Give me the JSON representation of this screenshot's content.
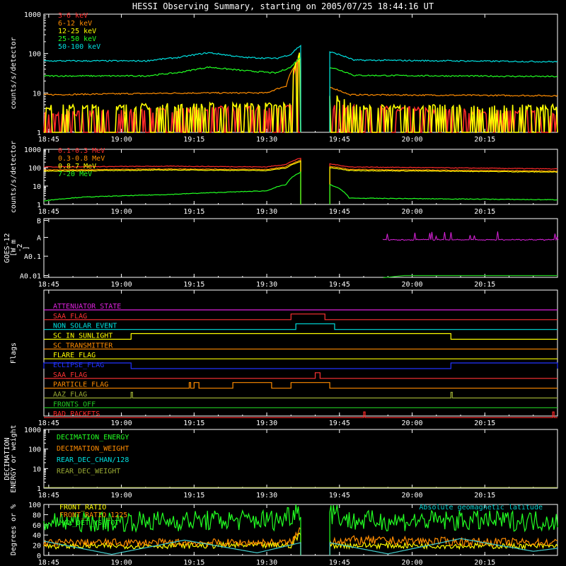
{
  "title": "HESSI Observing Summary, starting on 2005/07/25 18:44:16 UT",
  "time_axis": {
    "start": "18:44:16",
    "range": [
      "18:44",
      "20:30"
    ],
    "tick_labels": [
      "18:45",
      "19:00",
      "19:15",
      "19:30",
      "19:45",
      "20:00",
      "20:15"
    ],
    "data_gap": [
      "19:37",
      "19:43"
    ]
  },
  "chart_data": [
    {
      "type": "line",
      "panel": "hxr-low",
      "ylabel": "counts/s/detector",
      "yscale": "log",
      "ylim": [
        1,
        1000
      ],
      "ytick_labels": [
        "1",
        "10",
        "100",
        "1000"
      ],
      "series": [
        {
          "name": "3-6 keV",
          "color": "#ff2a2a",
          "kind": "noisy-low",
          "points": [
            [
              "18:44",
              2
            ],
            [
              "19:35",
              3
            ],
            [
              "19:37",
              70
            ],
            [
              "19:43",
              3
            ],
            [
              "20:30",
              2
            ]
          ]
        },
        {
          "name": "6-12 keV",
          "color": "#ff8c00",
          "points": [
            [
              "18:44",
              9
            ],
            [
              "19:00",
              9.5
            ],
            [
              "19:15",
              10
            ],
            [
              "19:30",
              10
            ],
            [
              "19:34",
              15
            ],
            [
              "19:37",
              70
            ],
            [
              "19:43",
              14
            ],
            [
              "19:47",
              9
            ],
            [
              "20:30",
              8.5
            ]
          ]
        },
        {
          "name": "12-25 keV",
          "color": "#ffff00",
          "kind": "noisy-low",
          "points": [
            [
              "18:44",
              3
            ],
            [
              "19:35",
              3.5
            ],
            [
              "19:37",
              80
            ],
            [
              "19:43",
              6
            ],
            [
              "19:48",
              3
            ],
            [
              "20:30",
              3
            ]
          ]
        },
        {
          "name": "25-50 keV",
          "color": "#22ff22",
          "points": [
            [
              "18:44",
              27
            ],
            [
              "19:05",
              27
            ],
            [
              "19:12",
              33
            ],
            [
              "19:18",
              45
            ],
            [
              "19:25",
              37
            ],
            [
              "19:32",
              32
            ],
            [
              "19:35",
              45
            ],
            [
              "19:37",
              80
            ],
            [
              "19:43",
              45
            ],
            [
              "19:48",
              28
            ],
            [
              "20:30",
              26
            ]
          ]
        },
        {
          "name": "50-100 keV",
          "color": "#00e0e0",
          "points": [
            [
              "18:44",
              65
            ],
            [
              "19:05",
              65
            ],
            [
              "19:12",
              80
            ],
            [
              "19:18",
              105
            ],
            [
              "19:25",
              80
            ],
            [
              "19:32",
              75
            ],
            [
              "19:35",
              95
            ],
            [
              "19:37",
              160
            ],
            [
              "19:43",
              110
            ],
            [
              "19:48",
              68
            ],
            [
              "20:30",
              62
            ]
          ]
        }
      ]
    },
    {
      "type": "line",
      "panel": "hxr-high",
      "ylabel": "counts/s/detector",
      "yscale": "log",
      "ylim": [
        1,
        1000
      ],
      "ytick_labels": [
        "1",
        "10",
        "100",
        "1000"
      ],
      "series": [
        {
          "name": "0.1-0.3 MeV",
          "color": "#ff2a2a",
          "points": [
            [
              "18:44",
              110
            ],
            [
              "19:10",
              120
            ],
            [
              "19:30",
              110
            ],
            [
              "19:34",
              150
            ],
            [
              "19:37",
              330
            ],
            [
              "19:43",
              160
            ],
            [
              "19:47",
              110
            ],
            [
              "20:30",
              85
            ]
          ]
        },
        {
          "name": "0.3-0.8 MeV",
          "color": "#ff8c00",
          "points": [
            [
              "18:44",
              75
            ],
            [
              "19:10",
              85
            ],
            [
              "19:30",
              80
            ],
            [
              "19:34",
              110
            ],
            [
              "19:37",
              250
            ],
            [
              "19:43",
              120
            ],
            [
              "19:47",
              80
            ],
            [
              "20:30",
              65
            ]
          ]
        },
        {
          "name": "0.8-7 MeV",
          "color": "#ffff00",
          "points": [
            [
              "18:44",
              65
            ],
            [
              "19:10",
              75
            ],
            [
              "19:30",
              70
            ],
            [
              "19:34",
              95
            ],
            [
              "19:37",
              220
            ],
            [
              "19:43",
              100
            ],
            [
              "19:47",
              70
            ],
            [
              "20:30",
              58
            ]
          ]
        },
        {
          "name": "7-20 MeV",
          "color": "#22ff22",
          "points": [
            [
              "18:44",
              1.6
            ],
            [
              "18:52",
              2.5
            ],
            [
              "19:10",
              3.5
            ],
            [
              "19:20",
              4.5
            ],
            [
              "19:30",
              5.5
            ],
            [
              "19:34",
              12
            ],
            [
              "19:37",
              55
            ],
            [
              "19:43",
              12
            ],
            [
              "19:47",
              2.2
            ],
            [
              "20:30",
              1.8
            ]
          ]
        }
      ]
    },
    {
      "type": "line",
      "panel": "goes",
      "ylabel": "GOES-12 [W m-2]",
      "ylabel_lines": [
        "GOES-12",
        "[W m",
        "-2",
        "]"
      ],
      "ytick_labels": [
        "B",
        "A",
        "A0.1",
        "A0.01"
      ],
      "series": [
        {
          "color": "#22cc22",
          "kind": "flat",
          "level": 0.97,
          "start": "19:54",
          "end": "20:30"
        },
        {
          "color": "#dd22dd",
          "kind": "spiky",
          "level": 0.36,
          "start": "19:54",
          "end": "20:30"
        }
      ]
    },
    {
      "type": "step",
      "panel": "flags",
      "ylabel": "Flags",
      "flags": [
        {
          "name": "ATTENUATOR_STATE",
          "color": "#dd22dd",
          "on": []
        },
        {
          "name": "SAA_FLAG",
          "color": "#ff3333",
          "on": [
            [
              "19:35",
              "19:42"
            ]
          ]
        },
        {
          "name": "NON_SOLAR_EVENT",
          "color": "#00e0e0",
          "on": [
            [
              "19:36",
              "19:44"
            ]
          ]
        },
        {
          "name": "SC_IN_SUNLIGHT",
          "color": "#ffff00",
          "on": [
            [
              "19:02",
              "20:08"
            ]
          ]
        },
        {
          "name": "SC_TRANSMITTER",
          "color": "#ff8c00",
          "on": []
        },
        {
          "name": "FLARE_FLAG",
          "color": "#ffff00",
          "on": []
        },
        {
          "name": "ECLIPSE_FLAG",
          "color": "#2233ff",
          "on": [
            [
              "18:44",
              "19:02"
            ],
            [
              "20:08",
              "20:30"
            ]
          ]
        },
        {
          "name": "SAA_FLAG",
          "color": "#ff3333",
          "on": [
            [
              "19:40",
              "19:41"
            ]
          ]
        },
        {
          "name": "PARTICLE_FLAG",
          "color": "#ff8c00",
          "on": [
            [
              "19:14",
              "19:14"
            ],
            [
              "19:15",
              "19:16"
            ],
            [
              "19:23",
              "19:31"
            ],
            [
              "19:35",
              "19:43"
            ]
          ]
        },
        {
          "name": "AAZ_FLAG",
          "color": "#99aa33",
          "on": [
            [
              "19:02",
              "19:02"
            ],
            [
              "20:08",
              "20:08"
            ]
          ]
        },
        {
          "name": "FRONTS_OFF",
          "color": "#22cc22",
          "on": []
        },
        {
          "name": "BAD_PACKETS",
          "color": "#ff2a2a",
          "on": [
            [
              "19:50",
              "19:50"
            ],
            [
              "20:29",
              "20:29"
            ]
          ]
        }
      ]
    },
    {
      "type": "line",
      "panel": "decimation",
      "ylabel": "DECIMATION ENERGY or weight",
      "ylabel_lines": [
        "DECIMATION",
        "ENERGY or weight"
      ],
      "yscale": "log",
      "ylim": [
        1,
        1000
      ],
      "ytick_labels": [
        "1",
        "10",
        "100",
        "1000"
      ],
      "series": [
        {
          "name": "DECIMATION_ENERGY",
          "color": "#22ff22"
        },
        {
          "name": "DECIMATION_WEIGHT",
          "color": "#ff8c00"
        },
        {
          "name": "REAR_DEC_CHAN/128",
          "color": "#00e0e0"
        },
        {
          "name": "REAR_DEC_WEIGHT",
          "color": "#99aa33"
        }
      ]
    },
    {
      "type": "line",
      "panel": "geo",
      "ylabel": "Degrees or %",
      "ylim": [
        0,
        100
      ],
      "ytick_labels": [
        "0",
        "20",
        "40",
        "60",
        "80",
        "100"
      ],
      "annotation": "Absolute geomagnetic latitude",
      "series": [
        {
          "name": "FRONT_RATIO",
          "color": "#ffff00",
          "kind": "noisy",
          "points": [
            [
              "18:44",
              18
            ],
            [
              "19:35",
              20
            ],
            [
              "19:37",
              45
            ],
            [
              "19:43",
              20
            ],
            [
              "20:30",
              18
            ]
          ]
        },
        {
          "name": "FRONT_RATIO_1225",
          "color": "#ff8c00",
          "kind": "noisy",
          "points": [
            [
              "18:44",
              25
            ],
            [
              "19:35",
              25
            ],
            [
              "19:37",
              50
            ],
            [
              "19:43",
              30
            ],
            [
              "20:30",
              25
            ]
          ]
        },
        {
          "name": "MAX_DET_VS_TOT",
          "color": "#22ff22",
          "kind": "noisy",
          "points": [
            [
              "18:44",
              65
            ],
            [
              "19:33",
              70
            ],
            [
              "19:37",
              95
            ],
            [
              "19:43",
              90
            ],
            [
              "19:47",
              68
            ],
            [
              "20:30",
              68
            ]
          ]
        },
        {
          "name": "Absolute geomagnetic latitude",
          "color": "#44cccc",
          "points": [
            [
              "18:44",
              28
            ],
            [
              "18:58",
              2
            ],
            [
              "19:13",
              30
            ],
            [
              "19:28",
              5
            ],
            [
              "19:37",
              25
            ],
            [
              "19:43",
              25
            ],
            [
              "19:55",
              3
            ],
            [
              "20:10",
              33
            ],
            [
              "20:25",
              8
            ],
            [
              "20:30",
              14
            ]
          ]
        }
      ]
    }
  ]
}
